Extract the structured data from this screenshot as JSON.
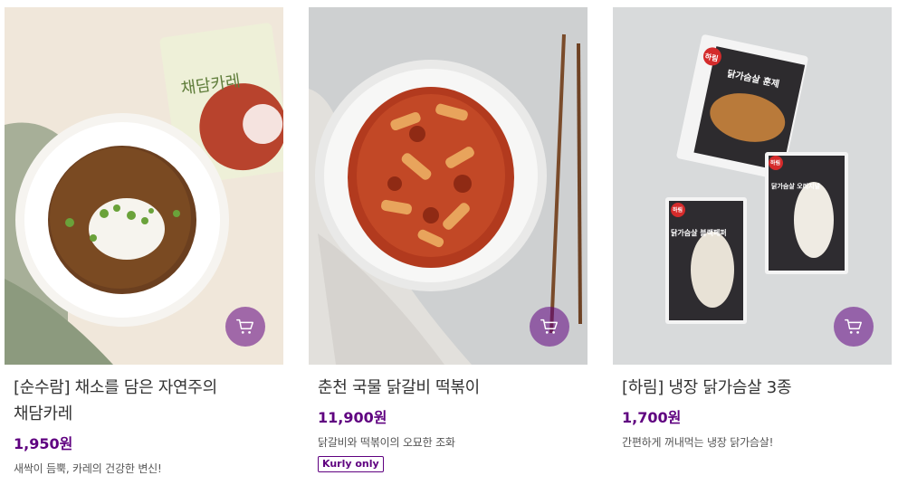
{
  "products": [
    {
      "name": "[순수람] 채소를 담은 자연주의 채담카레",
      "price": "1,950원",
      "description": "새싹이 듬뿍, 카레의 건강한 변신!",
      "tag": "",
      "package_text": "채담카레",
      "image_icon": "curry-bowl-image"
    },
    {
      "name": "춘천 국물 닭갈비 떡볶이",
      "price": "11,900원",
      "description": "닭갈비와 떡볶이의 오묘한 조화",
      "tag": "Kurly only",
      "image_icon": "tteokbokki-plate-image"
    },
    {
      "name": "[하림] 냉장 닭가슴살 3종",
      "price": "1,700원",
      "description": "간편하게 꺼내먹는 냉장 닭가슴살!",
      "tag": "",
      "package_brand": "하림",
      "package_labels": [
        "닭가슴살 훈제",
        "닭가슴살 블랙페퍼",
        "닭가슴살 오리지널"
      ],
      "image_icon": "chicken-breast-packages-image"
    }
  ],
  "cart_icon": "cart-icon",
  "colors": {
    "accent": "#5f0080",
    "cart_bg": "rgba(95,0,128,0.55)"
  }
}
